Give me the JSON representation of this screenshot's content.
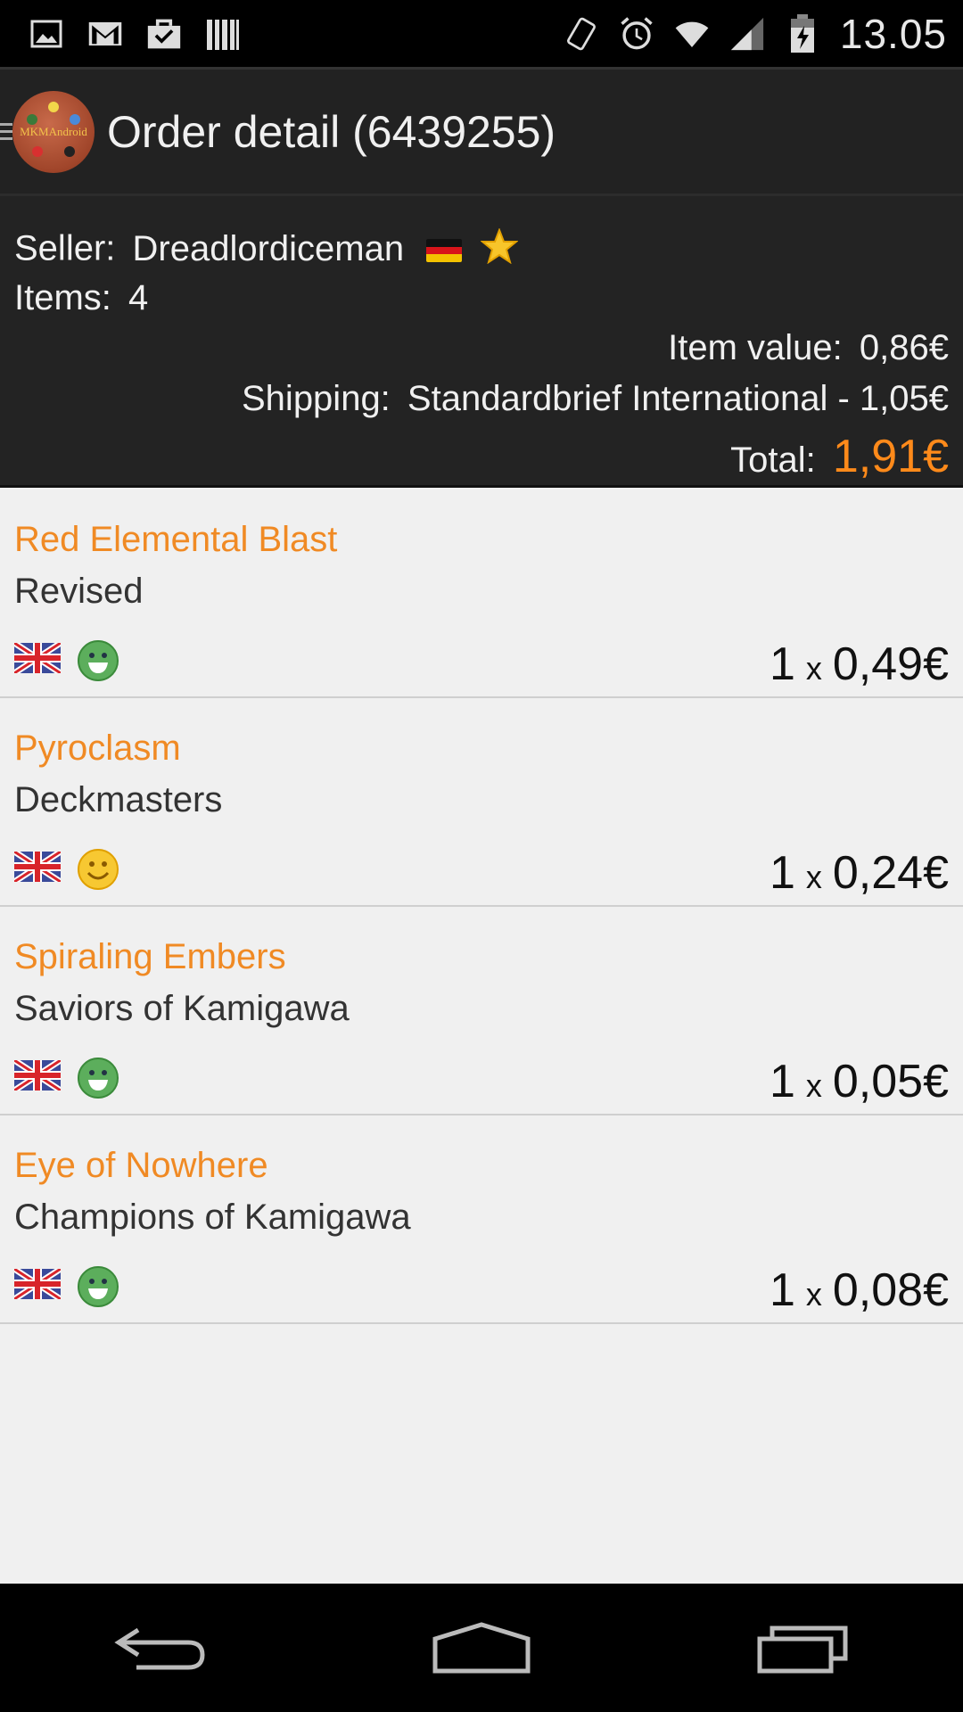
{
  "status_bar": {
    "time": "13.05",
    "left_icons": [
      "image-icon",
      "gmail-icon",
      "shopping-bag-icon",
      "barcode-icon"
    ],
    "right_icons": [
      "vibrate-icon",
      "alarm-icon",
      "wifi-icon",
      "signal-icon",
      "battery-charging-icon"
    ]
  },
  "header": {
    "logo_text": "MKMAndroid",
    "title": "Order detail (6439255)"
  },
  "summary": {
    "seller_label": "Seller:",
    "seller_name": "Dreadlordiceman",
    "seller_flag": "de-flag-icon",
    "seller_badge": "star-icon",
    "items_label": "Items:",
    "items_count": "4",
    "item_value_label": "Item value:",
    "item_value": "0,86€",
    "shipping_label": "Shipping:",
    "shipping_value": "Standardbrief International - 1,05€",
    "total_label": "Total:",
    "total_value": "1,91€",
    "total_color": "#ff8a1a"
  },
  "items": [
    {
      "name": "Red Elemental Blast",
      "set": "Revised",
      "language": "uk-flag-icon",
      "condition": "green-smiley-icon",
      "qty": "1",
      "x": "x",
      "price": "0,49€"
    },
    {
      "name": "Pyroclasm",
      "set": "Deckmasters",
      "language": "uk-flag-icon",
      "condition": "yellow-smiley-icon",
      "qty": "1",
      "x": "x",
      "price": "0,24€"
    },
    {
      "name": "Spiraling Embers",
      "set": "Saviors of Kamigawa",
      "language": "uk-flag-icon",
      "condition": "green-smiley-icon",
      "qty": "1",
      "x": "x",
      "price": "0,05€"
    },
    {
      "name": "Eye of Nowhere",
      "set": "Champions of Kamigawa",
      "language": "uk-flag-icon",
      "condition": "green-smiley-icon",
      "qty": "1",
      "x": "x",
      "price": "0,08€"
    }
  ],
  "nav_bar": {
    "buttons": [
      "back-icon",
      "home-icon",
      "recents-icon"
    ]
  },
  "colors": {
    "accent": "#f08a24",
    "actionbar": "#222222",
    "list_bg": "#f0f0f0"
  }
}
